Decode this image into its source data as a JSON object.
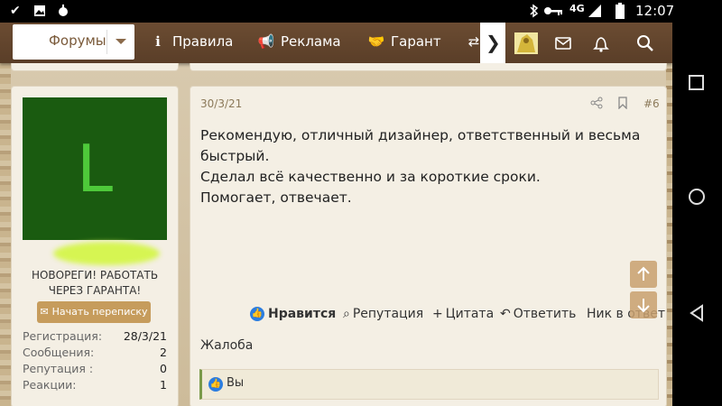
{
  "status_bar": {
    "time": "12:07",
    "network": "4G",
    "left_icons": [
      "check-icon",
      "image-icon",
      "android-icon"
    ],
    "right_icons": [
      "bluetooth-icon",
      "key-icon",
      "signal-icon",
      "battery-icon"
    ]
  },
  "header": {
    "forums_label": "Форумы",
    "nav": [
      {
        "label": "Правила",
        "icon": "info-icon"
      },
      {
        "label": "Реклама",
        "icon": "megaphone-icon"
      },
      {
        "label": "Гарант",
        "icon": "handshake-icon"
      }
    ],
    "more_icon": "chevron-right-icon"
  },
  "user": {
    "avatar_letter": "L",
    "title_line1": "НОВОРЕГИ! РАБОТАТЬ",
    "title_line2": "ЧЕРЕЗ ГАРАНТА!",
    "start_conversation": "Начать переписку",
    "stats": [
      {
        "label": "Регистрация:",
        "value": "28/3/21"
      },
      {
        "label": "Сообщения:",
        "value": "2"
      },
      {
        "label": "Репутация :",
        "value": "0"
      },
      {
        "label": "Реакции:",
        "value": "1"
      }
    ]
  },
  "post": {
    "date": "30/3/21",
    "number": "#6",
    "lines": [
      "Рекомендую, отличный дизайнер, ответственный и весьма",
      "быстрый.",
      "Сделал всё качественно и за короткие сроки.",
      "Помогает, отвечает."
    ],
    "actions": {
      "like": "Нравится",
      "reputation": "Репутация",
      "quote": "Цитата",
      "reply": "Ответить",
      "nick": "Ник в ответ"
    },
    "report": "Жалоба",
    "reactions_text": "Вы"
  },
  "colors": {
    "header_brown": "#5f432c",
    "avatar_bg": "#1a5b10",
    "avatar_letter": "#4ec93a",
    "button_tan": "#c69c5c",
    "like_blue": "#2b7de0"
  }
}
